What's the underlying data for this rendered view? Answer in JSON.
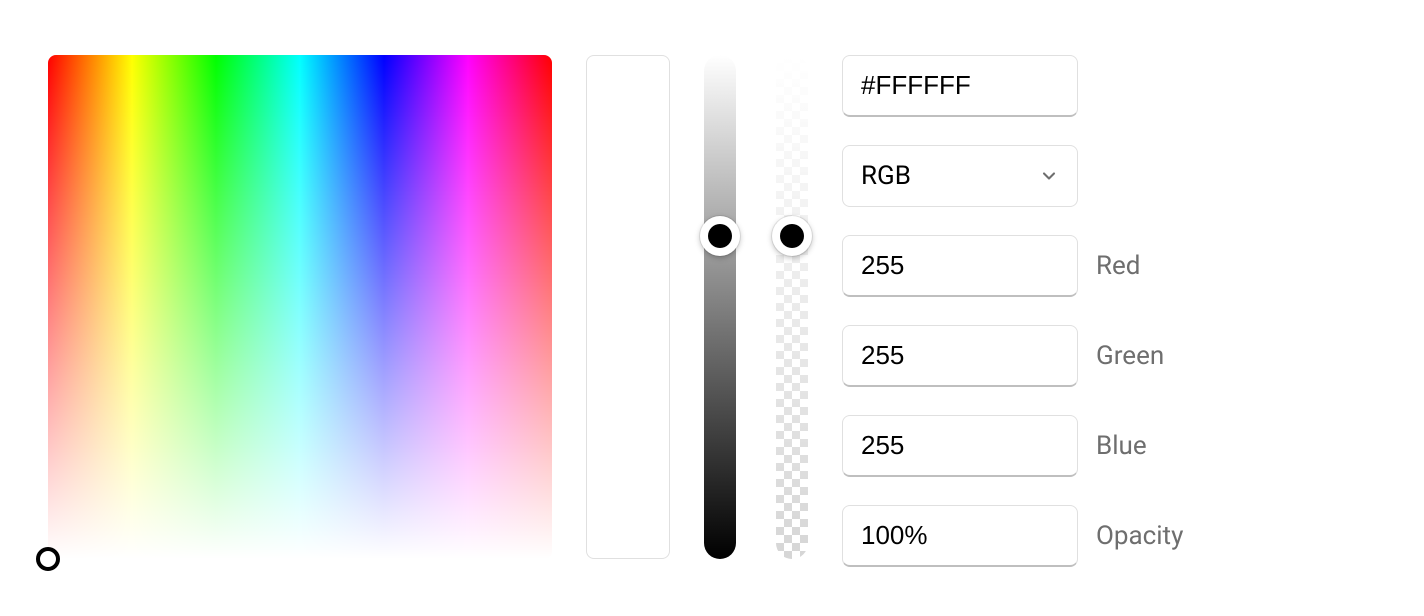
{
  "hex": "#FFFFFF",
  "format": {
    "selected": "RGB"
  },
  "channels": {
    "red": {
      "value": "255",
      "label": "Red"
    },
    "green": {
      "value": "255",
      "label": "Green"
    },
    "blue": {
      "value": "255",
      "label": "Blue"
    }
  },
  "opacity": {
    "value": "100%",
    "label": "Opacity"
  }
}
